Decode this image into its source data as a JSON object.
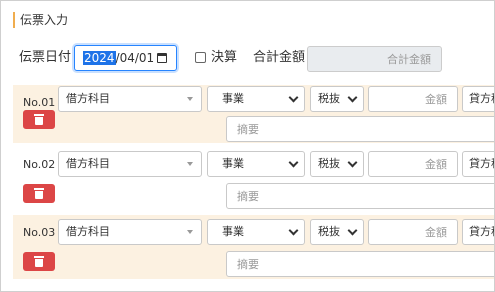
{
  "page": {
    "title": "伝票入力"
  },
  "header": {
    "date_label": "伝票日付",
    "date_year": "2024",
    "date_rest": "/04/01",
    "kessan_label": "決算",
    "total_label": "合計金額",
    "total_placeholder": "合計金額"
  },
  "rows": [
    {
      "no": "No.01",
      "account": "借方科目",
      "category": "事業",
      "tax": "税抜",
      "amount_placeholder": "金額",
      "credit": "貸方科目",
      "memo_placeholder": "摘要"
    },
    {
      "no": "No.02",
      "account": "借方科目",
      "category": "事業",
      "tax": "税抜",
      "amount_placeholder": "金額",
      "credit": "貸方科目",
      "memo_placeholder": "摘要"
    },
    {
      "no": "No.03",
      "account": "借方科目",
      "category": "事業",
      "tax": "税抜",
      "amount_placeholder": "金額",
      "credit": "貸方科目",
      "memo_placeholder": "摘要"
    }
  ],
  "colors": {
    "row_bg": "#fcf1e1",
    "delete_button": "#dc4646",
    "title_accent": "#f0ad4e",
    "focus": "#2684ff"
  },
  "icons": {
    "delete": "trash-icon",
    "date": "calendar-icon",
    "select": "chevron-down-icon"
  }
}
